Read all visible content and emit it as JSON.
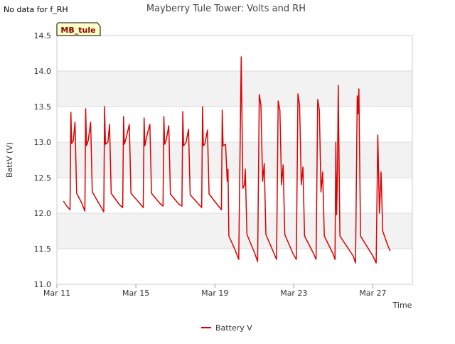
{
  "no_data_note": "No data for f_RH",
  "station_badge": "MB_tule",
  "colors": {
    "series": "#dd0000",
    "band": "#f2f2f2",
    "grid": "#dcdcdc",
    "badge_bg": "#ffffc8",
    "badge_text": "#8b0000"
  },
  "chart_data": {
    "type": "line",
    "title": "Mayberry Tule Tower: Volts and RH",
    "xlabel": "Time",
    "ylabel": "BattV (V)",
    "ylim": [
      11.0,
      14.5
    ],
    "yticks": [
      "11.0",
      "11.5",
      "12.0",
      "12.5",
      "13.0",
      "13.5",
      "14.0",
      "14.5"
    ],
    "xlim": [
      "2024-03-11",
      "2024-03-29"
    ],
    "xticks": [
      {
        "date": "2024-03-11",
        "label": "Mar 11"
      },
      {
        "date": "2024-03-15",
        "label": "Mar 15"
      },
      {
        "date": "2024-03-19",
        "label": "Mar 19"
      },
      {
        "date": "2024-03-23",
        "label": "Mar 23"
      },
      {
        "date": "2024-03-27",
        "label": "Mar 27"
      }
    ],
    "grid": true,
    "legend_position": "bottom-center",
    "series": [
      {
        "name": "Battery V",
        "points": [
          [
            "2024-03-11T08:00",
            12.17
          ],
          [
            "2024-03-11T12:00",
            12.1
          ],
          [
            "2024-03-11T16:00",
            12.05
          ],
          [
            "2024-03-11T17:00",
            13.42
          ],
          [
            "2024-03-11T18:00",
            12.98
          ],
          [
            "2024-03-11T20:00",
            13.02
          ],
          [
            "2024-03-11T22:00",
            13.28
          ],
          [
            "2024-03-12T00:00",
            12.28
          ],
          [
            "2024-03-12T06:00",
            12.15
          ],
          [
            "2024-03-12T10:00",
            12.03
          ],
          [
            "2024-03-12T11:00",
            13.47
          ],
          [
            "2024-03-12T12:00",
            12.95
          ],
          [
            "2024-03-12T14:00",
            13.02
          ],
          [
            "2024-03-12T17:00",
            13.28
          ],
          [
            "2024-03-12T19:00",
            12.3
          ],
          [
            "2024-03-13T04:00",
            12.12
          ],
          [
            "2024-03-13T09:00",
            12.02
          ],
          [
            "2024-03-13T10:00",
            13.5
          ],
          [
            "2024-03-13T11:00",
            12.97
          ],
          [
            "2024-03-13T14:00",
            13.0
          ],
          [
            "2024-03-13T16:00",
            13.25
          ],
          [
            "2024-03-13T18:00",
            12.28
          ],
          [
            "2024-03-14T04:00",
            12.12
          ],
          [
            "2024-03-14T08:00",
            12.08
          ],
          [
            "2024-03-14T09:00",
            13.36
          ],
          [
            "2024-03-14T10:00",
            12.97
          ],
          [
            "2024-03-14T12:00",
            13.05
          ],
          [
            "2024-03-14T16:00",
            13.25
          ],
          [
            "2024-03-14T18:00",
            12.28
          ],
          [
            "2024-03-15T04:00",
            12.15
          ],
          [
            "2024-03-15T09:00",
            12.08
          ],
          [
            "2024-03-15T10:00",
            13.34
          ],
          [
            "2024-03-15T11:00",
            12.95
          ],
          [
            "2024-03-15T14:00",
            13.12
          ],
          [
            "2024-03-15T17:00",
            13.25
          ],
          [
            "2024-03-15T19:00",
            12.28
          ],
          [
            "2024-03-16T05:00",
            12.14
          ],
          [
            "2024-03-16T09:00",
            12.1
          ],
          [
            "2024-03-16T10:00",
            13.36
          ],
          [
            "2024-03-16T11:00",
            12.97
          ],
          [
            "2024-03-16T13:00",
            13.03
          ],
          [
            "2024-03-16T16:00",
            13.23
          ],
          [
            "2024-03-16T18:00",
            12.27
          ],
          [
            "2024-03-17T04:00",
            12.13
          ],
          [
            "2024-03-17T08:00",
            12.1
          ],
          [
            "2024-03-17T09:00",
            13.43
          ],
          [
            "2024-03-17T10:00",
            12.95
          ],
          [
            "2024-03-17T13:00",
            13.0
          ],
          [
            "2024-03-17T16:00",
            13.18
          ],
          [
            "2024-03-17T18:00",
            12.26
          ],
          [
            "2024-03-18T04:00",
            12.13
          ],
          [
            "2024-03-18T08:00",
            12.08
          ],
          [
            "2024-03-18T09:00",
            13.5
          ],
          [
            "2024-03-18T10:00",
            12.95
          ],
          [
            "2024-03-18T12:00",
            12.98
          ],
          [
            "2024-03-18T15:00",
            13.17
          ],
          [
            "2024-03-18T17:00",
            12.27
          ],
          [
            "2024-03-19T03:00",
            12.12
          ],
          [
            "2024-03-19T08:00",
            12.05
          ],
          [
            "2024-03-19T09:00",
            13.45
          ],
          [
            "2024-03-19T10:00",
            12.95
          ],
          [
            "2024-03-19T13:00",
            12.97
          ],
          [
            "2024-03-19T15:00",
            12.45
          ],
          [
            "2024-03-19T16:00",
            12.62
          ],
          [
            "2024-03-19T17:00",
            11.68
          ],
          [
            "2024-03-20T00:00",
            11.5
          ],
          [
            "2024-03-20T05:00",
            11.35
          ],
          [
            "2024-03-20T08:00",
            14.2
          ],
          [
            "2024-03-20T10:00",
            12.35
          ],
          [
            "2024-03-20T12:00",
            12.4
          ],
          [
            "2024-03-20T13:00",
            12.62
          ],
          [
            "2024-03-20T15:00",
            11.7
          ],
          [
            "2024-03-21T00:00",
            11.45
          ],
          [
            "2024-03-21T04:00",
            11.32
          ],
          [
            "2024-03-21T06:00",
            13.67
          ],
          [
            "2024-03-21T08:00",
            13.52
          ],
          [
            "2024-03-21T10:00",
            12.45
          ],
          [
            "2024-03-21T12:00",
            12.7
          ],
          [
            "2024-03-21T14:00",
            11.7
          ],
          [
            "2024-03-22T00:00",
            11.43
          ],
          [
            "2024-03-22T03:00",
            11.35
          ],
          [
            "2024-03-22T05:00",
            13.58
          ],
          [
            "2024-03-22T07:00",
            13.45
          ],
          [
            "2024-03-22T09:00",
            12.4
          ],
          [
            "2024-03-22T11:00",
            12.68
          ],
          [
            "2024-03-22T13:00",
            11.7
          ],
          [
            "2024-03-22T23:00",
            11.43
          ],
          [
            "2024-03-23T03:00",
            11.35
          ],
          [
            "2024-03-23T05:00",
            13.68
          ],
          [
            "2024-03-23T07:00",
            13.52
          ],
          [
            "2024-03-23T09:00",
            12.4
          ],
          [
            "2024-03-23T11:00",
            12.65
          ],
          [
            "2024-03-23T13:00",
            11.68
          ],
          [
            "2024-03-24T00:00",
            11.43
          ],
          [
            "2024-03-24T03:00",
            11.35
          ],
          [
            "2024-03-24T05:00",
            13.6
          ],
          [
            "2024-03-24T07:00",
            13.45
          ],
          [
            "2024-03-24T09:00",
            12.3
          ],
          [
            "2024-03-24T11:00",
            12.58
          ],
          [
            "2024-03-24T13:00",
            11.68
          ],
          [
            "2024-03-25T00:00",
            11.42
          ],
          [
            "2024-03-25T02:00",
            11.35
          ],
          [
            "2024-03-25T03:00",
            13.0
          ],
          [
            "2024-03-25T04:00",
            11.98
          ],
          [
            "2024-03-25T05:00",
            12.6
          ],
          [
            "2024-03-25T06:00",
            13.8
          ],
          [
            "2024-03-25T08:00",
            11.68
          ],
          [
            "2024-03-26T00:00",
            11.4
          ],
          [
            "2024-03-26T03:00",
            11.3
          ],
          [
            "2024-03-26T05:00",
            13.65
          ],
          [
            "2024-03-26T06:00",
            13.4
          ],
          [
            "2024-03-26T07:00",
            13.75
          ],
          [
            "2024-03-26T09:00",
            11.68
          ],
          [
            "2024-03-27T00:00",
            11.4
          ],
          [
            "2024-03-27T04:00",
            11.3
          ],
          [
            "2024-03-27T06:00",
            13.1
          ],
          [
            "2024-03-27T08:00",
            12.0
          ],
          [
            "2024-03-27T10:00",
            12.58
          ],
          [
            "2024-03-27T12:00",
            11.75
          ],
          [
            "2024-03-27T18:00",
            11.55
          ],
          [
            "2024-03-27T21:00",
            11.47
          ]
        ]
      }
    ]
  }
}
